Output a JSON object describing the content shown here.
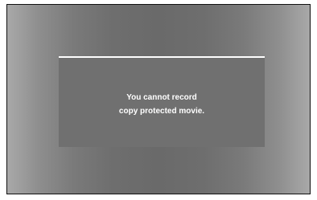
{
  "dialog": {
    "message_lines": [
      "You cannot record",
      "copy protected movie."
    ]
  },
  "colors": {
    "screen_edge": "#a9a9a9",
    "screen_center": "#6a6a6a",
    "dialog_background": "#707070",
    "dialog_top_border": "#ffffff",
    "text": "#ffffff"
  }
}
